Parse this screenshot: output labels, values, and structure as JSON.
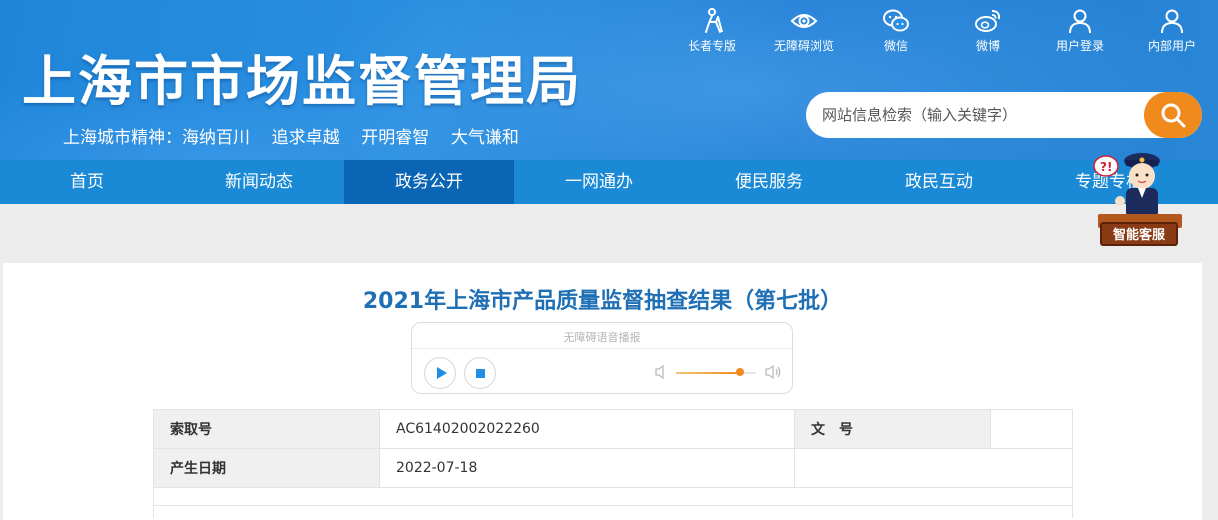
{
  "header": {
    "title": "上海市市场监督管理局",
    "slogan": "上海城市精神：海纳百川    追求卓越    开明睿智    大气谦和",
    "tools": [
      {
        "label": "长者专版",
        "icon": "elder-icon"
      },
      {
        "label": "无障碍浏览",
        "icon": "eye-icon"
      },
      {
        "label": "微信",
        "icon": "wechat-icon"
      },
      {
        "label": "微博",
        "icon": "weibo-icon"
      },
      {
        "label": "用户登录",
        "icon": "user-icon"
      },
      {
        "label": "内部用户",
        "icon": "user-icon"
      }
    ],
    "search": {
      "placeholder": "网站信息检索（输入关键字）",
      "icon": "search-icon",
      "accent": "#f08a1c"
    }
  },
  "nav": {
    "items": [
      "首页",
      "新闻动态",
      "政务公开",
      "一网通办",
      "便民服务",
      "政民互动",
      "专题专栏"
    ],
    "active": "政务公开",
    "bg": "#1a8ad6",
    "active_bg": "#0a66b4"
  },
  "assistant": {
    "label": "智能客服"
  },
  "article": {
    "title": "2021年上海市产品质量监督抽查结果（第七批）",
    "title_color": "#1f6fb5"
  },
  "player": {
    "caption": "无障碍语音播报",
    "volume_level": 0.8,
    "accent": "#1e8ee6"
  },
  "meta": {
    "rows": [
      {
        "k1": "索取号",
        "v1": "AC61402002022260",
        "k2": "文　号",
        "v2": ""
      },
      {
        "k1": "产生日期",
        "v1": "2022-07-18"
      }
    ]
  }
}
